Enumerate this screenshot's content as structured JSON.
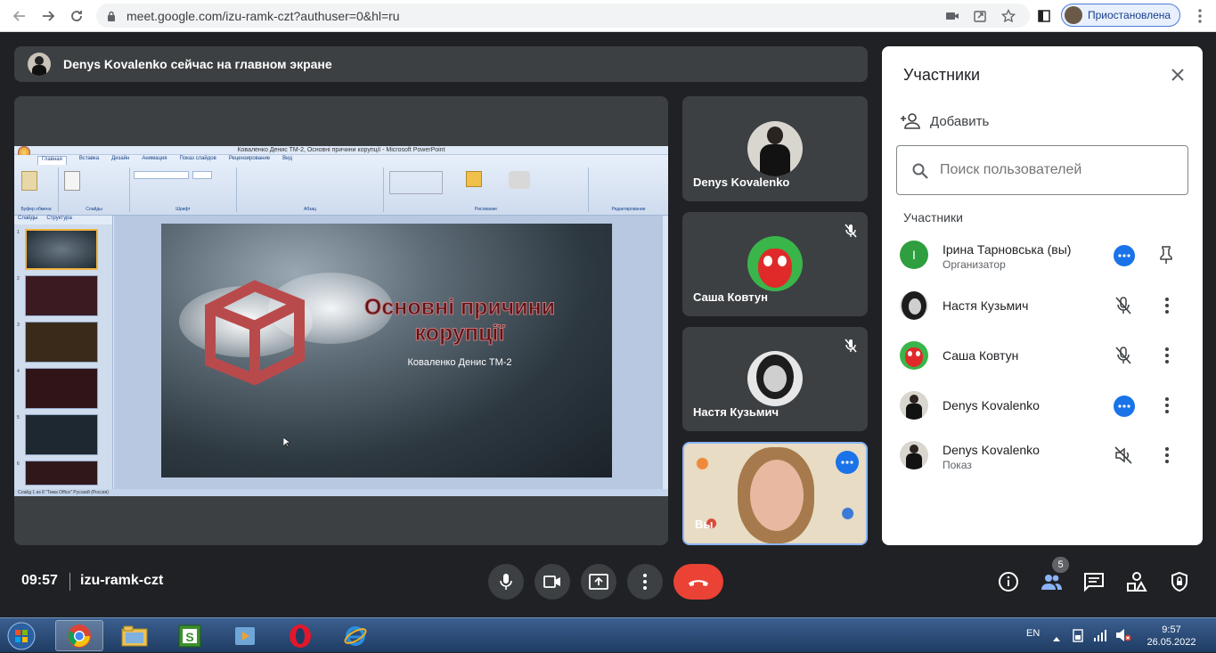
{
  "browser": {
    "url": "meet.google.com/izu-ramk-czt?authuser=0&hl=ru",
    "profile_status": "Приостановлена"
  },
  "banner": {
    "text": "Denys Kovalenko сейчас на главном экране"
  },
  "presentation": {
    "window_title": "Коваленко Денис ТМ-2, Основні причини корупції - Microsoft PowerPoint",
    "ribbon_tabs": [
      "Главная",
      "Вставка",
      "Дизайн",
      "Анимация",
      "Показ слайдов",
      "Рецензирование",
      "Вид"
    ],
    "ribbon_groups": [
      "Буфер обмена",
      "Слайды",
      "Шрифт",
      "Абзац",
      "Рисование",
      "Редактирование"
    ],
    "thumb_tabs": [
      "Слайды",
      "Структура"
    ],
    "thumb_numbers": [
      "1",
      "2",
      "3",
      "4",
      "5",
      "6"
    ],
    "slide_title": "Основні причини корупції",
    "slide_subtitle": "Коваленко Денис ТМ-2",
    "status_bar": "Слайд 1 из 8   \"Тема Office\"   Русский (Россия)"
  },
  "tiles": [
    {
      "name": "Denys Kovalenko",
      "muted": false
    },
    {
      "name": "Саша Ковтун",
      "muted": true
    },
    {
      "name": "Настя Кузьмич",
      "muted": true
    },
    {
      "name": "Вы",
      "muted": false
    }
  ],
  "panel": {
    "title": "Участники",
    "add_label": "Добавить",
    "search_placeholder": "Поиск пользователей",
    "section_label": "Участники",
    "participants": [
      {
        "name": "Ірина Тарновська (вы)",
        "role": "Организатор",
        "avatar_letter": "I"
      },
      {
        "name": "Настя Кузьмич",
        "role": ""
      },
      {
        "name": "Саша Ковтун",
        "role": ""
      },
      {
        "name": "Denys Kovalenko",
        "role": ""
      },
      {
        "name": "Denys Kovalenko",
        "role": "Показ"
      }
    ]
  },
  "bottom": {
    "time": "09:57",
    "meeting_code": "izu-ramk-czt",
    "participants_count": "5"
  },
  "taskbar": {
    "lang": "EN",
    "clock_time": "9:57",
    "clock_date": "26.05.2022"
  },
  "colors": {
    "meet_bg": "#202124",
    "tile_bg": "#3c4043",
    "accent_blue": "#1a73e8",
    "end_call_red": "#ea4335"
  }
}
